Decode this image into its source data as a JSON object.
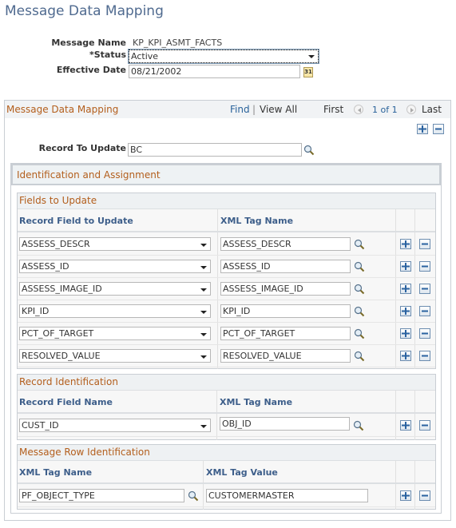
{
  "page": {
    "title": "Message Data Mapping"
  },
  "header": {
    "message_name_label": "Message Name",
    "message_name_value": "KP_KPI_ASMT_FACTS",
    "status_label": "*Status",
    "status_value": "Active",
    "effective_date_label": "Effective Date",
    "effective_date_value": "08/21/2002",
    "calendar_icon_text": "31"
  },
  "mapping": {
    "title": "Message Data Mapping",
    "find_label": "Find",
    "separator": "|",
    "view_all_label": "View All",
    "first_label": "First",
    "page_indicator": "1 of 1",
    "last_label": "Last",
    "record_to_update_label": "Record To Update",
    "record_to_update_value": "BC",
    "ia_title": "Identification and Assignment"
  },
  "fields_to_update": {
    "title": "Fields to Update",
    "columns": [
      "Record Field to Update",
      "XML Tag Name"
    ],
    "rows": [
      {
        "field": "ASSESS_DESCR",
        "xml_tag": "ASSESS_DESCR"
      },
      {
        "field": "ASSESS_ID",
        "xml_tag": "ASSESS_ID"
      },
      {
        "field": "ASSESS_IMAGE_ID",
        "xml_tag": "ASSESS_IMAGE_ID"
      },
      {
        "field": "KPI_ID",
        "xml_tag": "KPI_ID"
      },
      {
        "field": "PCT_OF_TARGET",
        "xml_tag": "PCT_OF_TARGET"
      },
      {
        "field": "RESOLVED_VALUE",
        "xml_tag": "RESOLVED_VALUE"
      }
    ]
  },
  "record_identification": {
    "title": "Record Identification",
    "columns": [
      "Record Field Name",
      "XML Tag Name"
    ],
    "rows": [
      {
        "field": "CUST_ID",
        "xml_tag": "OBJ_ID"
      }
    ]
  },
  "message_row_identification": {
    "title": "Message Row Identification",
    "columns": [
      "XML Tag Name",
      "XML Tag Value"
    ],
    "rows": [
      {
        "xml_tag_name": "PF_OBJECT_TYPE",
        "xml_tag_value": "CUSTOMERMASTER"
      }
    ]
  },
  "colors": {
    "title_blue": "#4f6a8f",
    "section_orange": "#b35e1c",
    "column_header_blue": "#3d5e8a",
    "link_blue": "#29629a",
    "border_gray": "#c9ced4"
  }
}
